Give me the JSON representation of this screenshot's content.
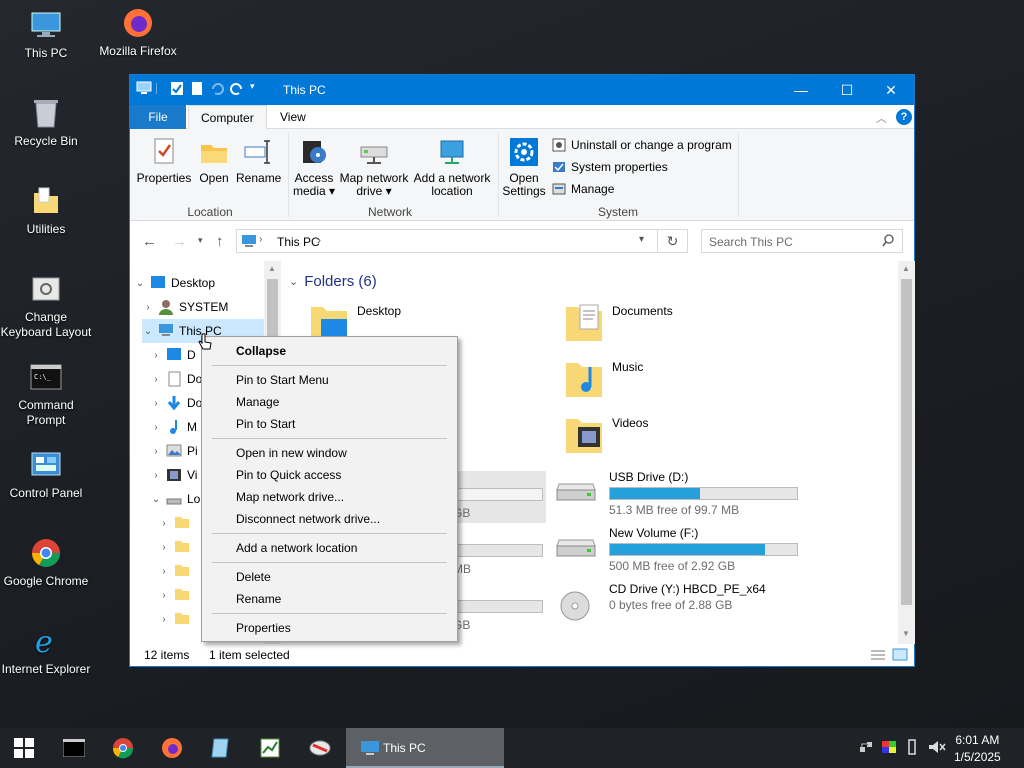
{
  "desktop": {
    "icons": [
      "This PC",
      "Mozilla Firefox",
      "Recycle Bin",
      "Utilities",
      "Change Keyboard Layout",
      "Command Prompt",
      "Control Panel",
      "Google Chrome",
      "Internet Explorer"
    ]
  },
  "window": {
    "title": "This PC",
    "controls": [
      "—",
      "☐",
      "✕"
    ],
    "tabs": {
      "file": "File",
      "computer": "Computer",
      "view": "View"
    },
    "ribbon": {
      "properties": "Properties",
      "open": "Open",
      "rename": "Rename",
      "access_media_1": "Access",
      "access_media_2": "media ▾",
      "map_drive_1": "Map network",
      "map_drive_2": "drive ▾",
      "add_loc_1": "Add a network",
      "add_loc_2": "location",
      "open_settings_1": "Open",
      "open_settings_2": "Settings",
      "uninstall": "Uninstall or change a program",
      "system_properties": "System properties",
      "manage": "Manage",
      "group_location": "Location",
      "group_network": "Network",
      "group_system": "System"
    },
    "address": {
      "path": "This PC",
      "search_placeholder": "Search This PC"
    },
    "tree": {
      "desktop": "Desktop",
      "system": "SYSTEM",
      "this_pc": "This PC",
      "children": [
        "D",
        "Do",
        "Do",
        "M",
        "Pi",
        "Vi",
        "Lo"
      ]
    },
    "content": {
      "folders_header": "Folders (6)",
      "folders": [
        "Desktop",
        "Documents",
        "Music",
        "Videos"
      ],
      "drives": [
        {
          "name": "USB Drive (D:)",
          "free": "51.3 MB free of 99.7 MB",
          "fill": 0.48
        },
        {
          "name": "New Volume (F:)",
          "free": "500 MB free of 2.92 GB",
          "fill": 0.83
        },
        {
          "name": "CD Drive (Y:) HBCD_PE_x64",
          "free": "0 bytes free of 2.88 GB",
          "fill": 1.0
        }
      ],
      "partial_left": [
        "GB",
        ")",
        "MB",
        "GB"
      ]
    },
    "status": {
      "items": "12 items",
      "selected": "1 item selected"
    }
  },
  "context_menu": {
    "collapse": "Collapse",
    "pin_start_menu": "Pin to Start Menu",
    "manage": "Manage",
    "pin_start": "Pin to Start",
    "open_new_window": "Open in new window",
    "pin_quick": "Pin to Quick access",
    "map_drive": "Map network drive...",
    "disconnect": "Disconnect network drive...",
    "add_location": "Add a network location",
    "delete": "Delete",
    "rename": "Rename",
    "properties": "Properties"
  },
  "taskbar": {
    "active_app": "This PC",
    "time": "6:01 AM",
    "date": "1/5/2025"
  },
  "colors": {
    "accent": "#0078d7",
    "drive_bar": "#26a0da",
    "taskbar": "#1f2226"
  }
}
